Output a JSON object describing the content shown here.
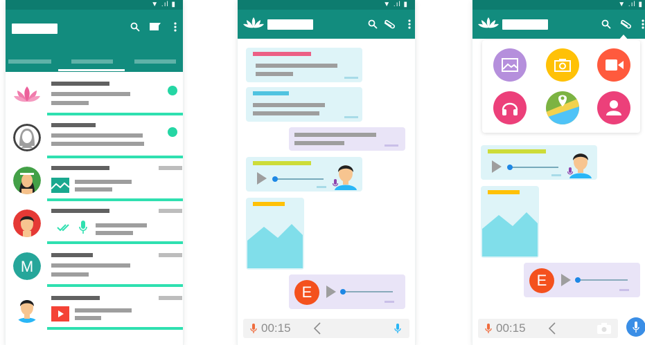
{
  "status_glyphs": "▼ .ıl ▮",
  "chat2": {
    "voice_time": "00:15",
    "voice_initial": "E"
  },
  "chat3": {
    "voice_time": "00:15",
    "voice_initial": "E"
  },
  "icons": {
    "search": "search-icon",
    "new_chat": "new-chat-icon",
    "menu": "more-vert-icon",
    "attach": "paperclip-icon",
    "mic": "mic-icon",
    "back": "chevron-left-icon",
    "camera": "camera-icon"
  },
  "colors": {
    "primary": "#128c7e",
    "status": "#0d7c6f",
    "accent": "#2fe0b0",
    "incoming": "#def4f8",
    "outgoing": "#e9e4f7",
    "gallery": "#b58fdc",
    "camera": "#ffc107",
    "video": "#ff5a3d",
    "audio": "#ec407a",
    "location": "#7cb342",
    "contact": "#ec407a"
  }
}
